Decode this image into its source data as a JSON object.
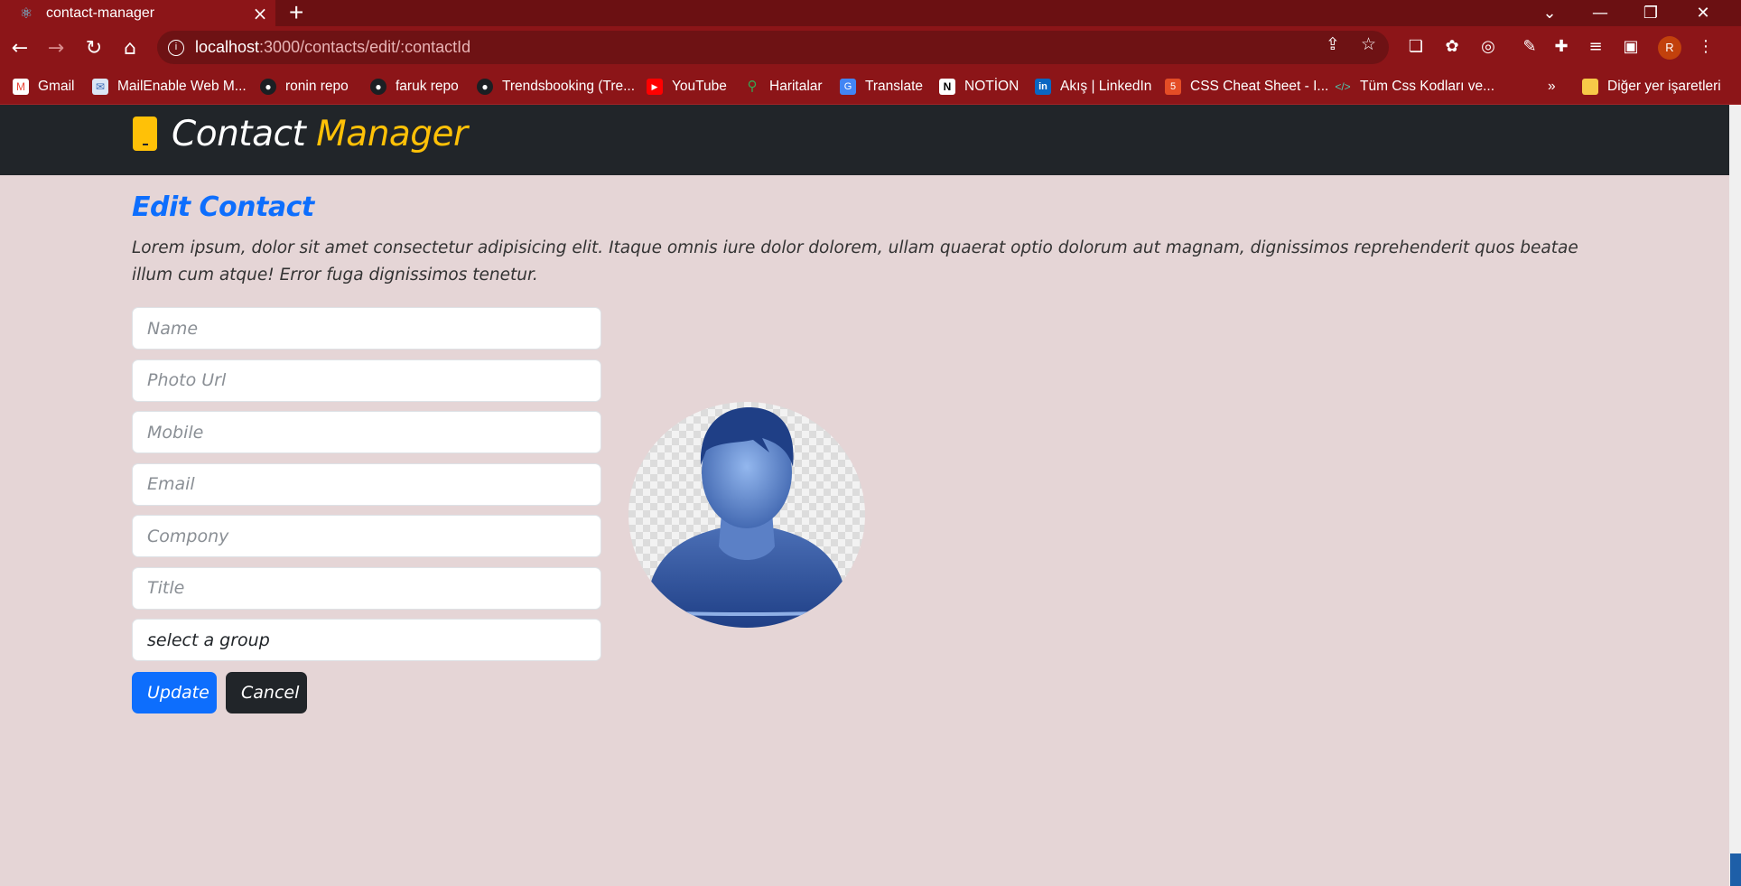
{
  "browser": {
    "tab_title": "contact-manager",
    "tab_icon": "react-icon",
    "url_host": "localhost",
    "url_rest": ":3000/contacts/edit/:contactId",
    "profile_initial": "R",
    "bookmarks": [
      {
        "label": "Gmail",
        "icon": "gmail-icon"
      },
      {
        "label": "MailEnable Web M...",
        "icon": "mail-icon"
      },
      {
        "label": "ronin repo",
        "icon": "github-icon"
      },
      {
        "label": "faruk repo",
        "icon": "github-icon"
      },
      {
        "label": "Trendsbooking (Tre...",
        "icon": "github-icon"
      },
      {
        "label": "YouTube",
        "icon": "youtube-icon"
      },
      {
        "label": "Haritalar",
        "icon": "maps-icon"
      },
      {
        "label": "Translate",
        "icon": "translate-icon"
      },
      {
        "label": "NOTİON",
        "icon": "notion-icon"
      },
      {
        "label": "Akış | LinkedIn",
        "icon": "linkedin-icon"
      },
      {
        "label": "CSS Cheat Sheet - I...",
        "icon": "html5-icon"
      },
      {
        "label": "Tüm Css Kodları ve...",
        "icon": "code-icon"
      }
    ],
    "bookmarks_overflow": "»",
    "other_bookmarks": "Diğer yer işaretleri"
  },
  "header": {
    "brand_part1": "Contact",
    "brand_part2": "Manager"
  },
  "page": {
    "title": "Edit Contact",
    "intro": "Lorem ipsum, dolor sit amet consectetur adipisicing elit. Itaque omnis iure dolor dolorem, ullam quaerat optio dolorum aut magnam, dignissimos reprehenderit quos beatae illum cum atque! Error fuga dignissimos tenetur."
  },
  "form": {
    "name_placeholder": "Name",
    "photo_placeholder": "Photo Url",
    "mobile_placeholder": "Mobile",
    "email_placeholder": "Email",
    "company_placeholder": "Compony",
    "title_placeholder": "Title",
    "group_selected": "select a group",
    "update_label": "Update",
    "cancel_label": "Cancel"
  },
  "colors": {
    "primary": "#0d6efd",
    "dark": "#212529",
    "warning": "#ffc107",
    "background": "#e5d5d6",
    "chrome": "#8c1518"
  }
}
